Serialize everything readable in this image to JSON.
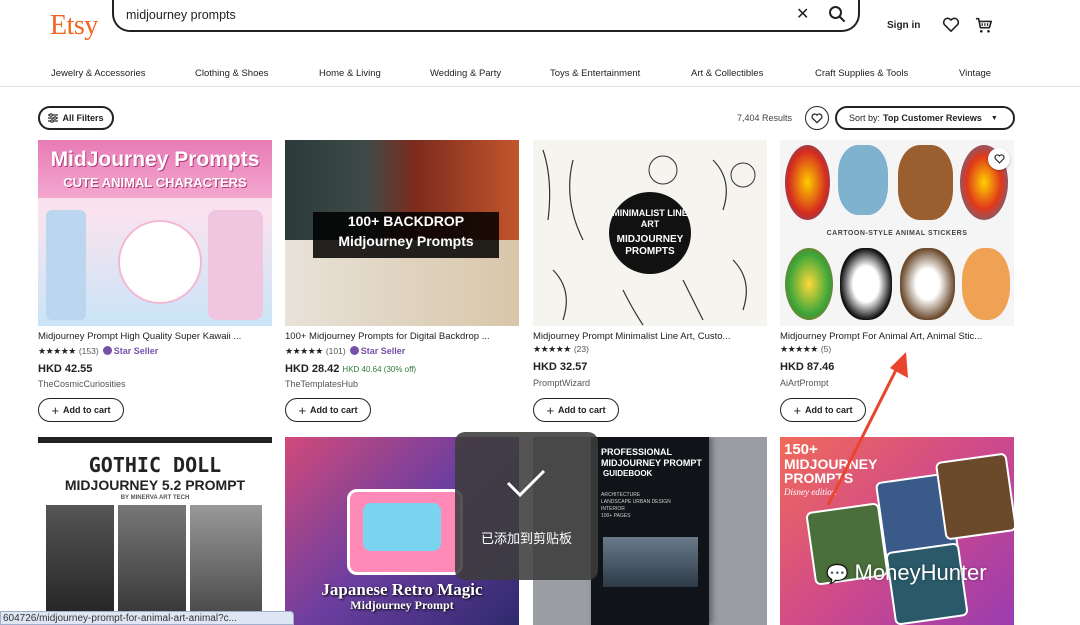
{
  "header": {
    "logo": "Etsy",
    "search_value": "midjourney prompts",
    "signin": "Sign in"
  },
  "categories": [
    "Jewelry & Accessories",
    "Clothing & Shoes",
    "Home & Living",
    "Wedding & Party",
    "Toys & Entertainment",
    "Art & Collectibles",
    "Craft Supplies & Tools",
    "Vintage"
  ],
  "toolbar": {
    "filters": "All Filters",
    "results": "7,404 Results",
    "sort_prefix": "Sort by:",
    "sort_value": "Top Customer Reviews"
  },
  "products": [
    {
      "img_title": "MidJourney Prompts",
      "img_sub": "CUTE ANIMAL CHARACTERS",
      "title": "Midjourney Prompt High Quality Super Kawaii ...",
      "stars": "★★★★★",
      "count": "(153)",
      "star_seller": "Star Seller",
      "price": "HKD 42.55",
      "old_price": "",
      "shop": "TheCosmicCuriosities",
      "addcart": "Add to cart"
    },
    {
      "img_title": "100+ BACKDROP",
      "img_sub": "Midjourney Prompts",
      "title": "100+ Midjourney Prompts for Digital Backdrop ...",
      "stars": "★★★★★",
      "count": "(101)",
      "star_seller": "Star Seller",
      "price": "HKD 28.42",
      "old_price": "HKD 40.64 (30% off)",
      "shop": "TheTemplatesHub",
      "addcart": "Add to cart"
    },
    {
      "img_title": "MINIMALIST LINE ART",
      "img_sub": "MIDJOURNEY PROMPTS",
      "title": "Midjourney Prompt Minimalist Line Art, Custo...",
      "stars": "★★★★★",
      "count": "(23)",
      "star_seller": "",
      "price": "HKD 32.57",
      "old_price": "",
      "shop": "PromptWizard",
      "addcart": "Add to cart"
    },
    {
      "img_title": "CARTOON-STYLE ANIMAL STICKERS",
      "img_sub": "",
      "title": "Midjourney Prompt For Animal Art, Animal Stic...",
      "stars": "★★★★★",
      "count": "(5)",
      "star_seller": "",
      "price": "HKD 87.46",
      "old_price": "",
      "shop": "AiArtPrompt",
      "addcart": "Add to cart"
    }
  ],
  "row2": [
    {
      "l1": "GOTHIC DOLL",
      "l2": "MIDJOURNEY 5.2 PROMPT",
      "l3": "BY MINERVA ART TECH"
    },
    {
      "l1": "Japanese Retro Magic",
      "l2": "Midjourney Prompt"
    },
    {
      "l1": "PROFESSIONAL",
      "l2": "MIDJOURNEY PROMPT",
      "l3": "GUIDEBOOK",
      "l4": "ARCHITECTURE",
      "l5": "LANDSCAPE URBAN DESIGN",
      "l6": "INTERIOR",
      "l7": "100+ PAGES"
    },
    {
      "l1": "150+",
      "l2": "MIDJOURNEY",
      "l3": "PROMPTS",
      "l4": "Disney edition"
    }
  ],
  "toast": "已添加到剪贴板",
  "status_url": "604726/midjourney-prompt-for-animal-art-animal?c...",
  "watermark": "MoneyHunter",
  "colors": {
    "brand": "#f1641e",
    "star_seller": "#7851a9",
    "discount": "#2f7a3a",
    "arrow": "#e8452c"
  }
}
